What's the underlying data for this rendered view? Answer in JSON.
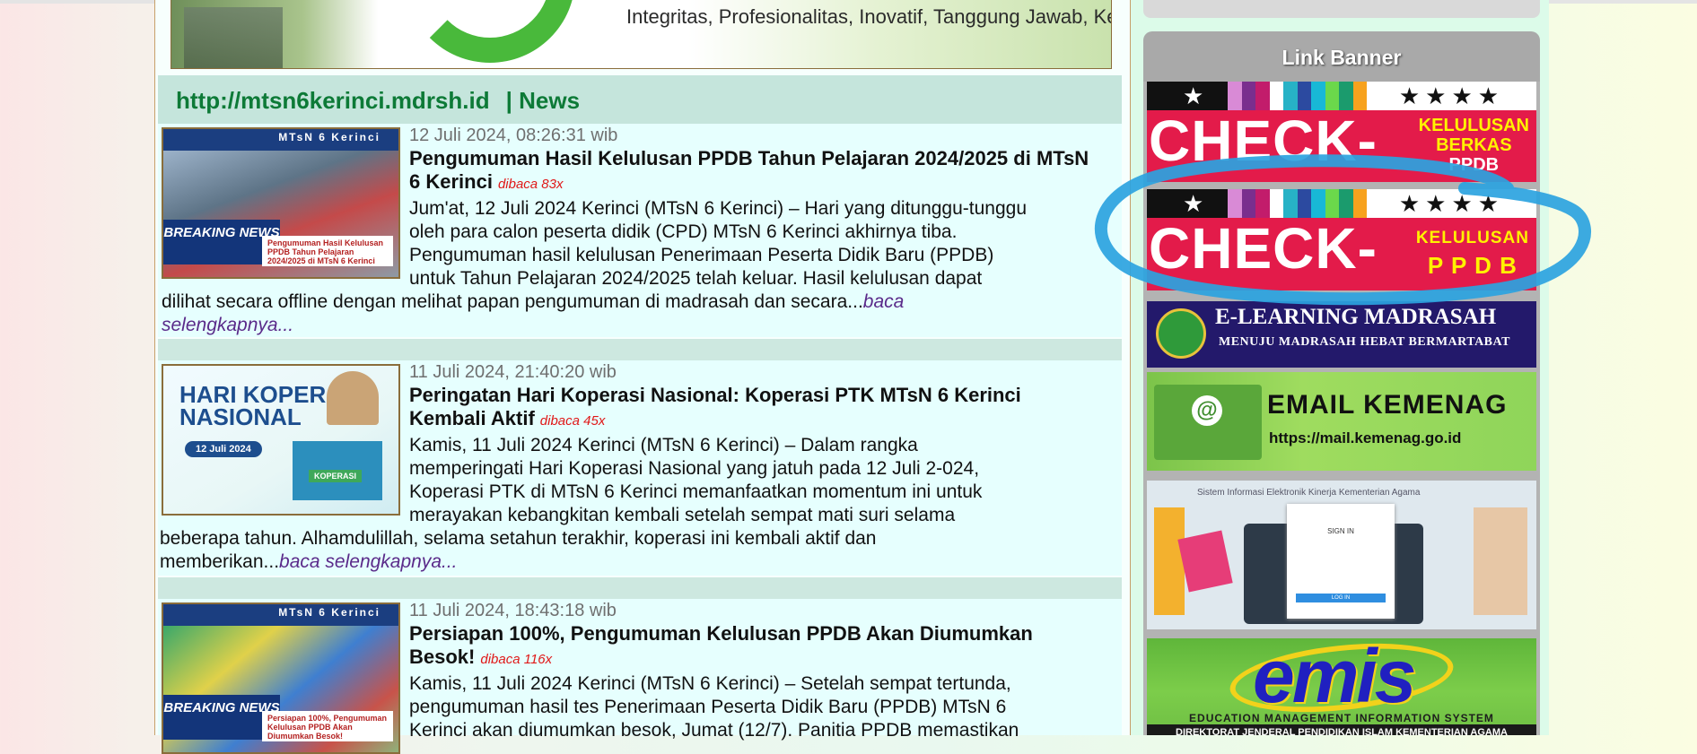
{
  "header": {
    "slogan": "Integritas, Profesionalitas, Inovatif, Tanggung Jawab, Keteladanan"
  },
  "news": {
    "site_link": "http://mtsn6kerinci.mdrsh.id",
    "section_label": "| News",
    "items": [
      {
        "date": "12 Juli 2024, 08:26:31 wib",
        "title": "Pengumuman Hasil Kelulusan PPDB Tahun Pelajaran 2024/2025 di MTsN 6 Kerinci",
        "views": "dibaca 83x",
        "thumb_header": "MTsN 6 Kerinci",
        "thumb_badge": "BREAKING NEWS",
        "thumb_caption": "Pengumuman Hasil Kelulusan PPDB Tahun Pelajaran 2024/2025 di MTsN 6 Kerinci",
        "lines": [
          "Jum'at, 12 Juli 2024 Kerinci (MTsN 6 Kerinci) – Hari yang ditunggu-tunggu",
          "oleh para calon peserta didik (CPD) MTsN 6 Kerinci akhirnya tiba.",
          "Pengumuman hasil kelulusan Penerimaan Peserta Didik Baru (PPDB)",
          "untuk Tahun Pelajaran 2024/2025 telah keluar. Hasil kelulusan dapat",
          "dilihat secara offline dengan melihat papan pengumuman di madrasah dan secara...",
          ""
        ],
        "more_a": "baca",
        "more_b": "selengkapnya..."
      },
      {
        "date": "11 Juli 2024, 21:40:20 wib",
        "title": "Peringatan Hari Koperasi Nasional: Koperasi PTK MTsN 6 Kerinci Kembali Aktif",
        "views": "dibaca 45x",
        "thumb_title": "HARI KOPERASI NASIONAL",
        "thumb_date": "12 Juli 2024",
        "thumb_house": "KOPERASI",
        "lines": [
          "Kamis, 11 Juli 2024 Kerinci (MTsN 6 Kerinci) – Dalam rangka",
          "memperingati Hari Koperasi Nasional yang jatuh pada 12 Juli 2-024,",
          "Koperasi PTK di MTsN 6 Kerinci memanfaatkan momentum ini untuk",
          "merayakan kebangkitan kembali setelah sempat mati suri selama",
          "beberapa tahun. Alhamdulillah, selama setahun terakhir, koperasi ini kembali aktif dan",
          "memberikan..."
        ],
        "more": "baca selengkapnya..."
      },
      {
        "date": "11 Juli 2024, 18:43:18 wib",
        "title": "Persiapan 100%, Pengumuman Kelulusan PPDB Akan Diumumkan Besok!",
        "views": "dibaca 116x",
        "thumb_header": "MTsN 6 Kerinci",
        "thumb_badge": "BREAKING NEWS",
        "thumb_caption": "Persiapan 100%, Pengumuman Kelulusan PPDB Akan Diumumkan Besok!",
        "lines": [
          "Kamis, 11 Juli 2024 Kerinci (MTsN 6 Kerinci) – Setelah sempat tertunda,",
          "pengumuman hasil tes Penerimaan Peserta Didik Baru (PPDB) MTsN 6",
          "Kerinci akan diumumkan besok, Jumat (12/7). Panitia PPDB memastikan"
        ]
      }
    ]
  },
  "sidebar": {
    "title": "Link Banner",
    "banners": {
      "berkas": {
        "big": "CHECK-",
        "small_top": "KELULUSAN",
        "small_mid": "BERKAS",
        "small_bot": "PPDB"
      },
      "ppdb": {
        "big": "CHECK-",
        "small_top": "KELULUSAN",
        "small_bot": "P P D B"
      },
      "elearning": {
        "t1": "E-LEARNING MADRASAH",
        "t2": "MENUJU MADRASAH HEBAT BERMARTABAT"
      },
      "email": {
        "t1": "EMAIL KEMENAG",
        "t2": "https://mail.kemenag.go.id"
      },
      "sikin": {
        "head": "Sistem Informasi Elektronik Kinerja Kementerian Agama",
        "signin": "SIGN IN",
        "login": "LOG IN"
      },
      "emis": {
        "logo": "emis",
        "t1": "EDUCATION MANAGEMENT INFORMATION SYSTEM",
        "t2": "DIREKTORAT JENDERAL PENDIDIKAN ISLAM KEMENTERIAN AGAMA"
      }
    }
  },
  "colors": {
    "accent_green": "#0d7a37",
    "views_red": "#e01818",
    "link_purple": "#5a2a8a",
    "annotation_blue": "#2ba3e0"
  }
}
